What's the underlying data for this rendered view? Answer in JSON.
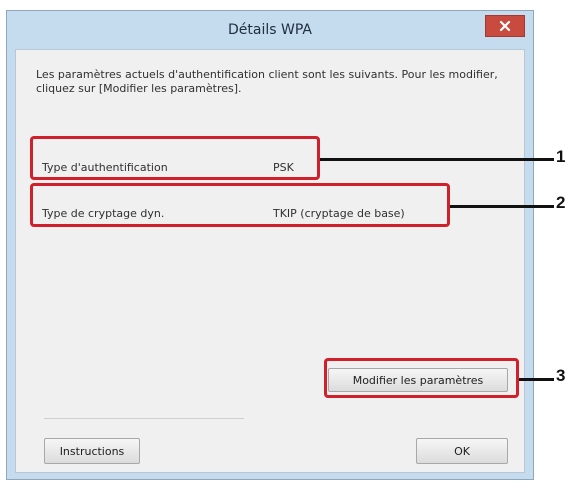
{
  "dialog": {
    "title": "Détails WPA",
    "description": "Les paramètres actuels d'authentification client sont les suivants. Pour les modifier, cliquez sur [Modifier les paramètres].",
    "fields": [
      {
        "label": "Type d'authentification",
        "value": "PSK"
      },
      {
        "label": "Type de cryptage dyn.",
        "value": "TKIP (cryptage de base)"
      }
    ],
    "buttons": {
      "modify": "Modifier les paramètres",
      "instructions": "Instructions",
      "ok": "OK"
    }
  },
  "callouts": [
    "1",
    "2",
    "3"
  ],
  "colors": {
    "highlight": "#d0202c",
    "close_button": "#c94b40",
    "window_frame": "#c4dced",
    "client_area": "#f0f0f0"
  },
  "icons": {
    "close": "close-icon"
  }
}
